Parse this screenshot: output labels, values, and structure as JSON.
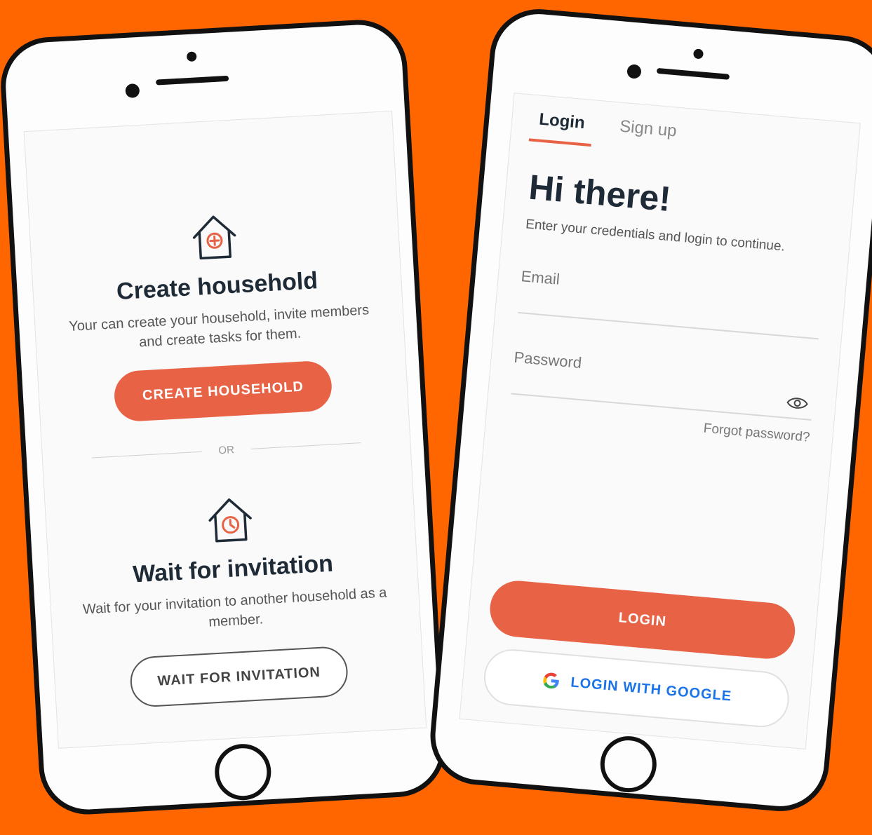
{
  "colors": {
    "background": "#ff6600",
    "accent": "#e86246",
    "google_blue": "#1a73e8"
  },
  "household_screen": {
    "create": {
      "icon": "house-plus-icon",
      "title": "Create household",
      "description": "Your can create your household, invite members and create tasks for them.",
      "button_label": "CREATE HOUSEHOLD"
    },
    "divider_label": "OR",
    "wait": {
      "icon": "house-clock-icon",
      "title": "Wait for invitation",
      "description": "Wait for your invitation to another household as a member.",
      "button_label": "WAIT FOR INVITATION"
    }
  },
  "login_screen": {
    "tabs": [
      {
        "label": "Login",
        "active": true
      },
      {
        "label": "Sign up",
        "active": false
      }
    ],
    "title": "Hi there!",
    "subtitle": "Enter your credentials and login to continue.",
    "email": {
      "placeholder": "Email",
      "value": ""
    },
    "password": {
      "placeholder": "Password",
      "value": "",
      "icon": "eye-icon"
    },
    "forgot_password": "Forgot password?",
    "login_button": "LOGIN",
    "google_button": "LOGIN WITH GOOGLE",
    "google_icon": "google-g-icon"
  }
}
